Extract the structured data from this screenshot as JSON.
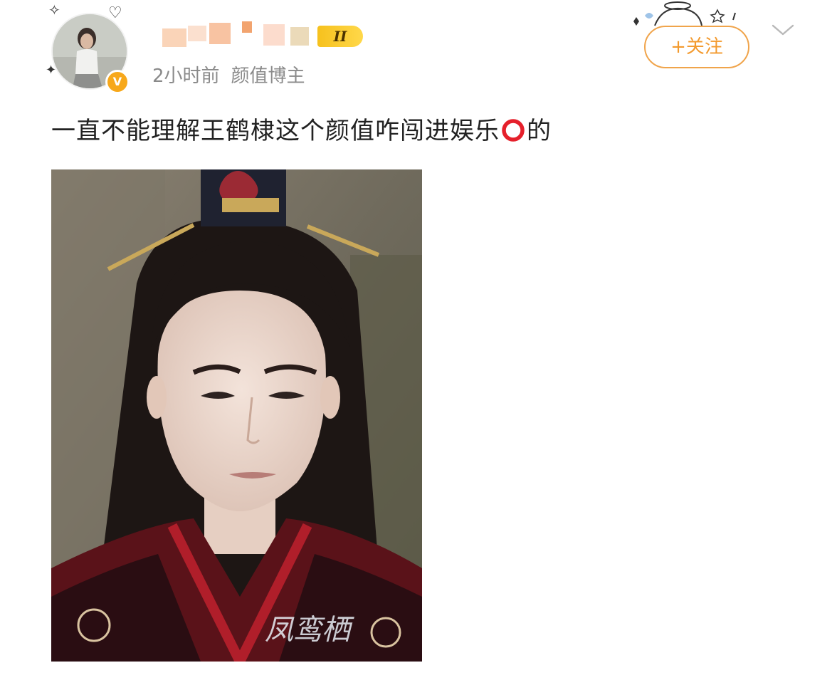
{
  "header": {
    "time_ago": "2小时前",
    "user_tag": "颜值博主",
    "level_badge": "II",
    "verified_symbol": "V",
    "follow_label": "+关注"
  },
  "post": {
    "text_before": "一直不能理解王鹤棣这个颜值咋闯进娱乐",
    "text_after": "的",
    "photo_watermark": "凤鸾栖"
  },
  "colors": {
    "accent_orange": "#f39a2e",
    "badge_gold": "#f6c11d",
    "meta_gray": "#8a8a8a",
    "text_dark": "#222222",
    "emoji_red": "#e5202b"
  },
  "icons": [
    "star-sparkle-icon",
    "heart-doodle-icon",
    "verified-icon",
    "chevron-down-icon",
    "red-circle-emoji-icon"
  ]
}
